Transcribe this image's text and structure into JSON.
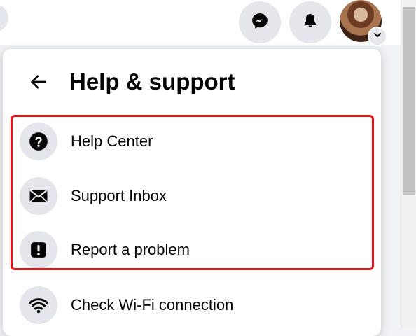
{
  "topbar": {
    "messenger_icon": "messenger-icon",
    "notifications_icon": "bell-icon",
    "account_icon": "chevron-down-icon"
  },
  "panel": {
    "title": "Help & support",
    "back_icon": "arrow-left-icon",
    "items": [
      {
        "label": "Help Center",
        "icon": "question-circle-icon"
      },
      {
        "label": "Support Inbox",
        "icon": "envelope-icon"
      },
      {
        "label": "Report a problem",
        "icon": "exclamation-icon"
      },
      {
        "label": "Check Wi-Fi connection",
        "icon": "wifi-icon"
      }
    ]
  },
  "colors": {
    "highlight": "#e8151b",
    "icon_bg": "#e4e6eb",
    "text": "#050505"
  }
}
